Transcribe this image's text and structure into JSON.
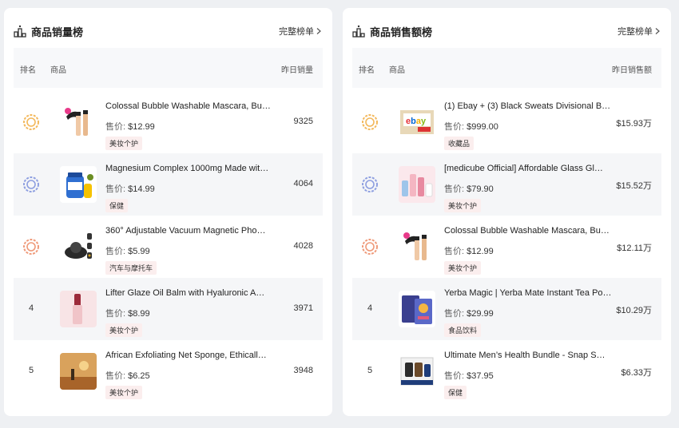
{
  "colors": {
    "gold": "#f3b85c",
    "silver": "#8e9fe0",
    "bronze": "#ef9a7a",
    "tag_bg": "#fbeeee"
  },
  "left": {
    "title": "商品销量榜",
    "more": "完整榜单",
    "headers": {
      "rank": "排名",
      "product": "商品",
      "value": "昨日销量"
    },
    "price_label": "售价:",
    "rows": [
      {
        "rank": "",
        "medal": "gold",
        "name": "Colossal Bubble Washable Mascara, Bu…",
        "price": "$12.99",
        "tag": "美妆个护",
        "value": "9325"
      },
      {
        "rank": "",
        "medal": "silver",
        "name": "Magnesium Complex 1000mg Made wit…",
        "price": "$14.99",
        "tag": "保健",
        "value": "4064"
      },
      {
        "rank": "",
        "medal": "bronze",
        "name": "360° Adjustable Vacuum Magnetic Pho…",
        "price": "$5.99",
        "tag": "汽车与摩托车",
        "value": "4028"
      },
      {
        "rank": "4",
        "medal": "",
        "name": "Lifter Glaze Oil Balm with Hyaluronic A…",
        "price": "$8.99",
        "tag": "美妆个护",
        "value": "3971"
      },
      {
        "rank": "5",
        "medal": "",
        "name": "African Exfoliating Net Sponge, Ethicall…",
        "price": "$6.25",
        "tag": "美妆个护",
        "value": "3948"
      }
    ]
  },
  "right": {
    "title": "商品销售额榜",
    "more": "完整榜单",
    "headers": {
      "rank": "排名",
      "product": "商品",
      "value": "昨日销售额"
    },
    "price_label": "售价:",
    "rows": [
      {
        "rank": "",
        "medal": "gold",
        "name": "(1) Ebay + (3) Black Sweats Divisional B…",
        "price": "$999.00",
        "tag": "收藏品",
        "value": "$15.93万"
      },
      {
        "rank": "",
        "medal": "silver",
        "name": "[medicube Official] Affordable Glass Gl…",
        "price": "$79.90",
        "tag": "美妆个护",
        "value": "$15.52万"
      },
      {
        "rank": "",
        "medal": "bronze",
        "name": "Colossal Bubble Washable Mascara, Bu…",
        "price": "$12.99",
        "tag": "美妆个护",
        "value": "$12.11万"
      },
      {
        "rank": "4",
        "medal": "",
        "name": "Yerba Magic | Yerba Mate Instant Tea Po…",
        "price": "$29.99",
        "tag": "食品饮料",
        "value": "$10.29万"
      },
      {
        "rank": "5",
        "medal": "",
        "name": "Ultimate Men’s Health Bundle - Snap S…",
        "price": "$37.95",
        "tag": "保健",
        "value": "$6.33万"
      }
    ]
  }
}
